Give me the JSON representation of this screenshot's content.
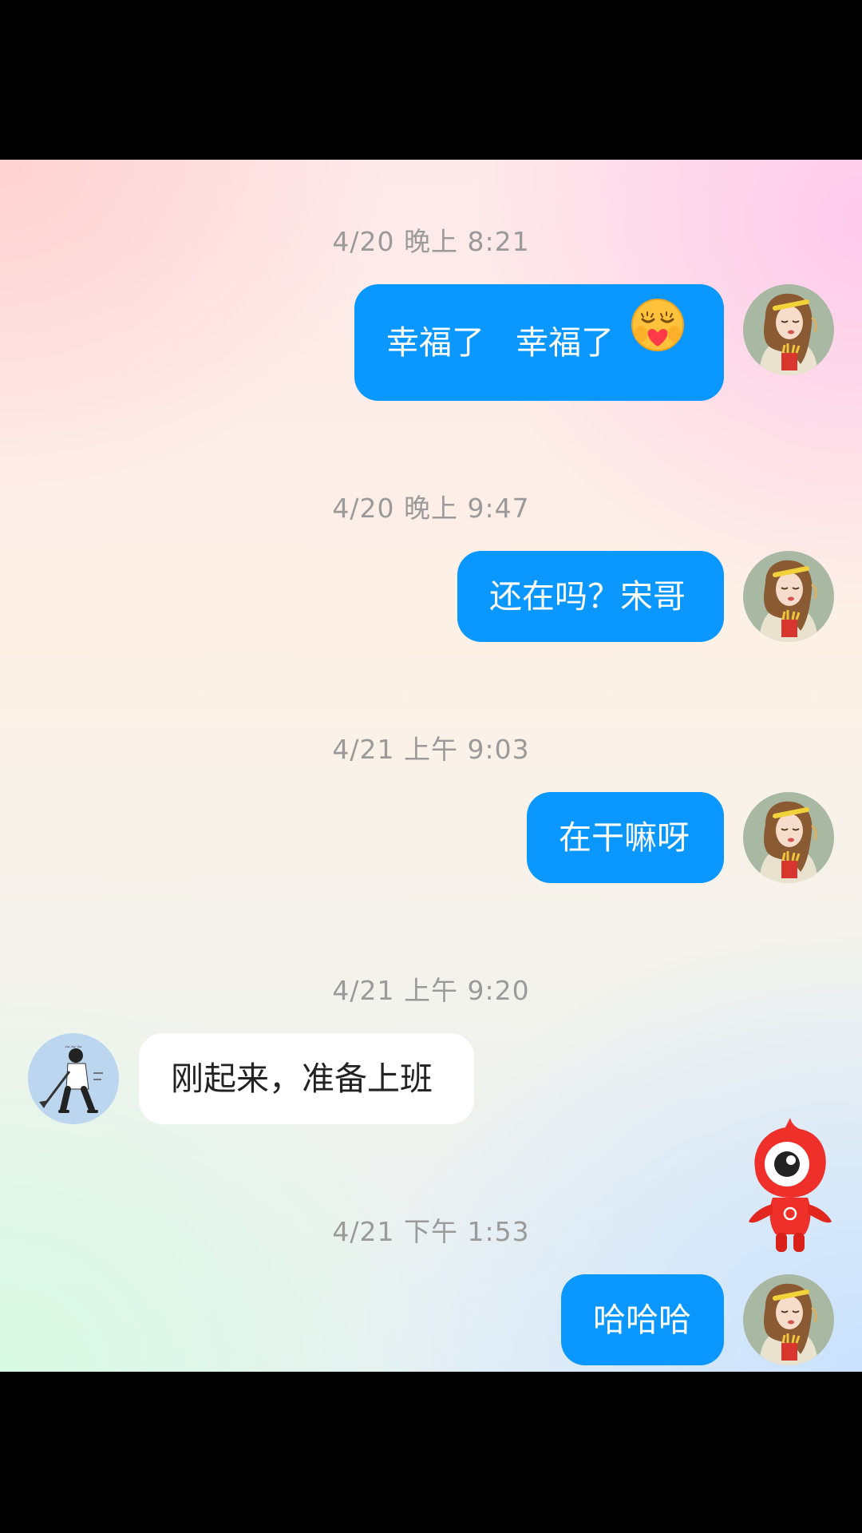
{
  "messages": [
    {
      "timestamp": "4/20 晚上 8:21",
      "sender": "me",
      "text": "幸福了   幸福了",
      "emoji": "heart-eyes-smiling-face"
    },
    {
      "timestamp": "4/20 晚上 9:47",
      "sender": "me",
      "text": "还在吗？宋哥"
    },
    {
      "timestamp": "4/21 上午 9:03",
      "sender": "me",
      "text": "在干嘛呀"
    },
    {
      "timestamp": "4/21 上午 9:20",
      "sender": "contact",
      "text": "刚起来，准备上班"
    },
    {
      "timestamp": "4/21 下午 1:53",
      "sender": "me",
      "text": "哈哈哈"
    }
  ],
  "colors": {
    "outgoing_bubble": "#0a97ff",
    "incoming_bubble": "#ffffff",
    "timestamp_text": "#9a9a9a"
  },
  "icons": {
    "my_avatar": "girl-avatar",
    "contact_avatar": "boy-with-shovel-avatar",
    "floating_widget": "red-mascot-icon"
  }
}
